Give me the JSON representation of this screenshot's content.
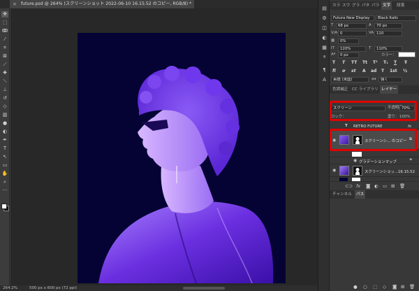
{
  "document": {
    "tab_title": "future.psd @ 264% (スクリーンショット 2022-06-10 16.15.52 のコピー, RGB/8) *",
    "close_glyph": "×"
  },
  "status": {
    "zoom": "264.2%",
    "doc_size": "500 px x 600 px (72 ppi)"
  },
  "toolbar": {
    "tools": [
      {
        "name": "move-tool-icon",
        "glyph": "✥"
      },
      {
        "name": "marquee-tool-icon",
        "glyph": "⬚"
      },
      {
        "name": "lasso-tool-icon",
        "glyph": "ↂ"
      },
      {
        "name": "magic-wand-tool-icon",
        "glyph": "⁄"
      },
      {
        "name": "crop-tool-icon",
        "glyph": "⌗"
      },
      {
        "name": "frame-tool-icon",
        "glyph": "⊠"
      },
      {
        "name": "eyedropper-tool-icon",
        "glyph": "⟋"
      },
      {
        "name": "healing-brush-tool-icon",
        "glyph": "✚"
      },
      {
        "name": "brush-tool-icon",
        "glyph": "⟍"
      },
      {
        "name": "clone-stamp-tool-icon",
        "glyph": "⊥"
      },
      {
        "name": "history-brush-tool-icon",
        "glyph": "↺"
      },
      {
        "name": "eraser-tool-icon",
        "glyph": "◇"
      },
      {
        "name": "gradient-tool-icon",
        "glyph": "▥"
      },
      {
        "name": "blur-tool-icon",
        "glyph": "●"
      },
      {
        "name": "dodge-tool-icon",
        "glyph": "◐"
      },
      {
        "name": "pen-tool-icon",
        "glyph": "✒"
      },
      {
        "name": "type-tool-icon",
        "glyph": "T"
      },
      {
        "name": "path-selection-tool-icon",
        "glyph": "↖"
      },
      {
        "name": "rectangle-tool-icon",
        "glyph": "▭"
      },
      {
        "name": "hand-tool-icon",
        "glyph": "✋"
      },
      {
        "name": "zoom-tool-icon",
        "glyph": "⌕"
      },
      {
        "name": "more-tools-icon",
        "glyph": "···"
      }
    ]
  },
  "panel_strip": {
    "icons": [
      "history-icon",
      "properties-icon",
      "swatches-icon",
      "adjustments-icon",
      "libraries-icon",
      "glyphs-icon",
      "paragraph-icon",
      "character-icon"
    ]
  },
  "character_panel": {
    "tabs": [
      "カラ",
      "スウ",
      "グラ",
      "パタ",
      "パラ",
      "文字",
      "段落"
    ],
    "active_tab": "文字",
    "font_family": "Futura New Display",
    "font_style": "Black Italic",
    "font_size": "68 px",
    "leading": "70 px",
    "kerning": "0",
    "tracking": "110",
    "tsume": "0%",
    "vertical_scale": "120%",
    "horizontal_scale": "110%",
    "baseline_shift": "0 px",
    "color_label": "カラー：",
    "color_value": "#ffffff",
    "type_buttons": [
      "T",
      "T",
      "TT",
      "Tt",
      "T¹",
      "T₁",
      "T",
      "Ŧ"
    ],
    "opentype_buttons": [
      "fi",
      "ơ",
      "st",
      "A",
      "ad",
      "T",
      "1st",
      "½"
    ],
    "language": "英語 (米国)",
    "anti_alias_label": "aa",
    "anti_alias": "強く"
  },
  "layers_panel": {
    "tabs": [
      "色調補正",
      "CC ライブラリ",
      "レイヤー"
    ],
    "active_tab": "レイヤー",
    "blend_mode": "スクリーン",
    "opacity_label": "不透明度：",
    "opacity": "70%",
    "lock_label": "ロック：",
    "fill_label": "塗り：",
    "fill": "100%",
    "layers": [
      {
        "type": "text",
        "name": "RETRO FUTURE",
        "visible": false
      },
      {
        "type": "image",
        "name": "スクリーンシ... のコピー",
        "visible": true,
        "selected": true
      },
      {
        "type": "adjustment",
        "name": "",
        "visible": false
      },
      {
        "type": "effect",
        "name": "グラデーションマップ",
        "visible": true
      },
      {
        "type": "image",
        "name": "スクリーンショッ...16.15.52",
        "visible": true
      },
      {
        "type": "background",
        "name": "",
        "visible": false
      }
    ],
    "fx_label": "fx"
  },
  "bottom_panel": {
    "tabs": [
      "チャンネル",
      "パス"
    ],
    "active_tab": "パス"
  },
  "colors": {
    "canvas_bg": "#050334",
    "highlight": "#e00000",
    "purple": "#7a3ff0"
  }
}
